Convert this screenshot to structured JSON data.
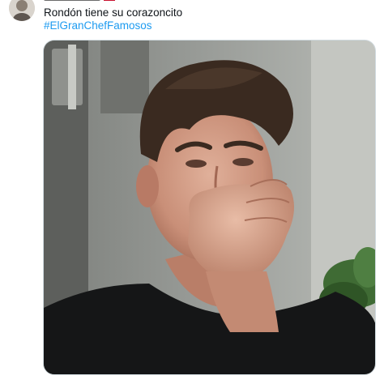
{
  "tweet": {
    "text": "Rondón tiene su corazoncito",
    "hashtag": "#ElGranChefFamosos"
  },
  "media": {
    "kind": "image"
  },
  "colors": {
    "text": "#0f1419",
    "hashtag": "#1d9bf0",
    "border": "#cfd9de",
    "background": "#ffffff"
  },
  "icons": [
    "avatar"
  ]
}
